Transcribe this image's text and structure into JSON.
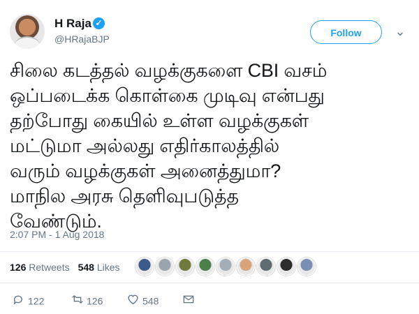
{
  "author": {
    "name": "H Raja",
    "handle": "@HRajaBJP"
  },
  "follow_label": "Follow",
  "tweet": {
    "lines": [
      "சிலை கடத்தல் வழக்குகளை CBI வசம்",
      "ஒப்படைக்க கொள்கை முடிவு என்பது",
      "தற்போது கையில் உள்ள வழக்குகள்",
      "மட்டுமா அல்லது எதிர்காலத்தில்",
      "வரும் வழக்குகள் அனைத்துமா?",
      "மாநில அரசு தெளிவுபடுத்த",
      "வேண்டும்."
    ],
    "timestamp": "2:07 PM - 1 Aug 2018"
  },
  "stats": {
    "retweets_count": "126",
    "retweets_label": "Retweets",
    "likes_count": "548",
    "likes_label": "Likes"
  },
  "likers": [
    {
      "color": "#3c5a8a"
    },
    {
      "color": "#9aa5ae"
    },
    {
      "color": "#6f7a3c"
    },
    {
      "color": "#4d7f4a"
    },
    {
      "color": "#a4aeb6"
    },
    {
      "color": "#d8a47c"
    },
    {
      "color": "#5f6c6f"
    },
    {
      "color": "#2d2d2d"
    },
    {
      "color": "#7a8fb3"
    }
  ],
  "actions": {
    "replies": "122",
    "retweets": "126",
    "likes": "548"
  },
  "icons": {
    "verified": "verified-badge-icon",
    "chevron": "chevron-down-icon",
    "reply": "reply-icon",
    "retweet": "retweet-icon",
    "like": "heart-icon",
    "message": "envelope-icon"
  },
  "colors": {
    "accent": "#1da1f2",
    "muted": "#657786",
    "text": "#14171a"
  }
}
